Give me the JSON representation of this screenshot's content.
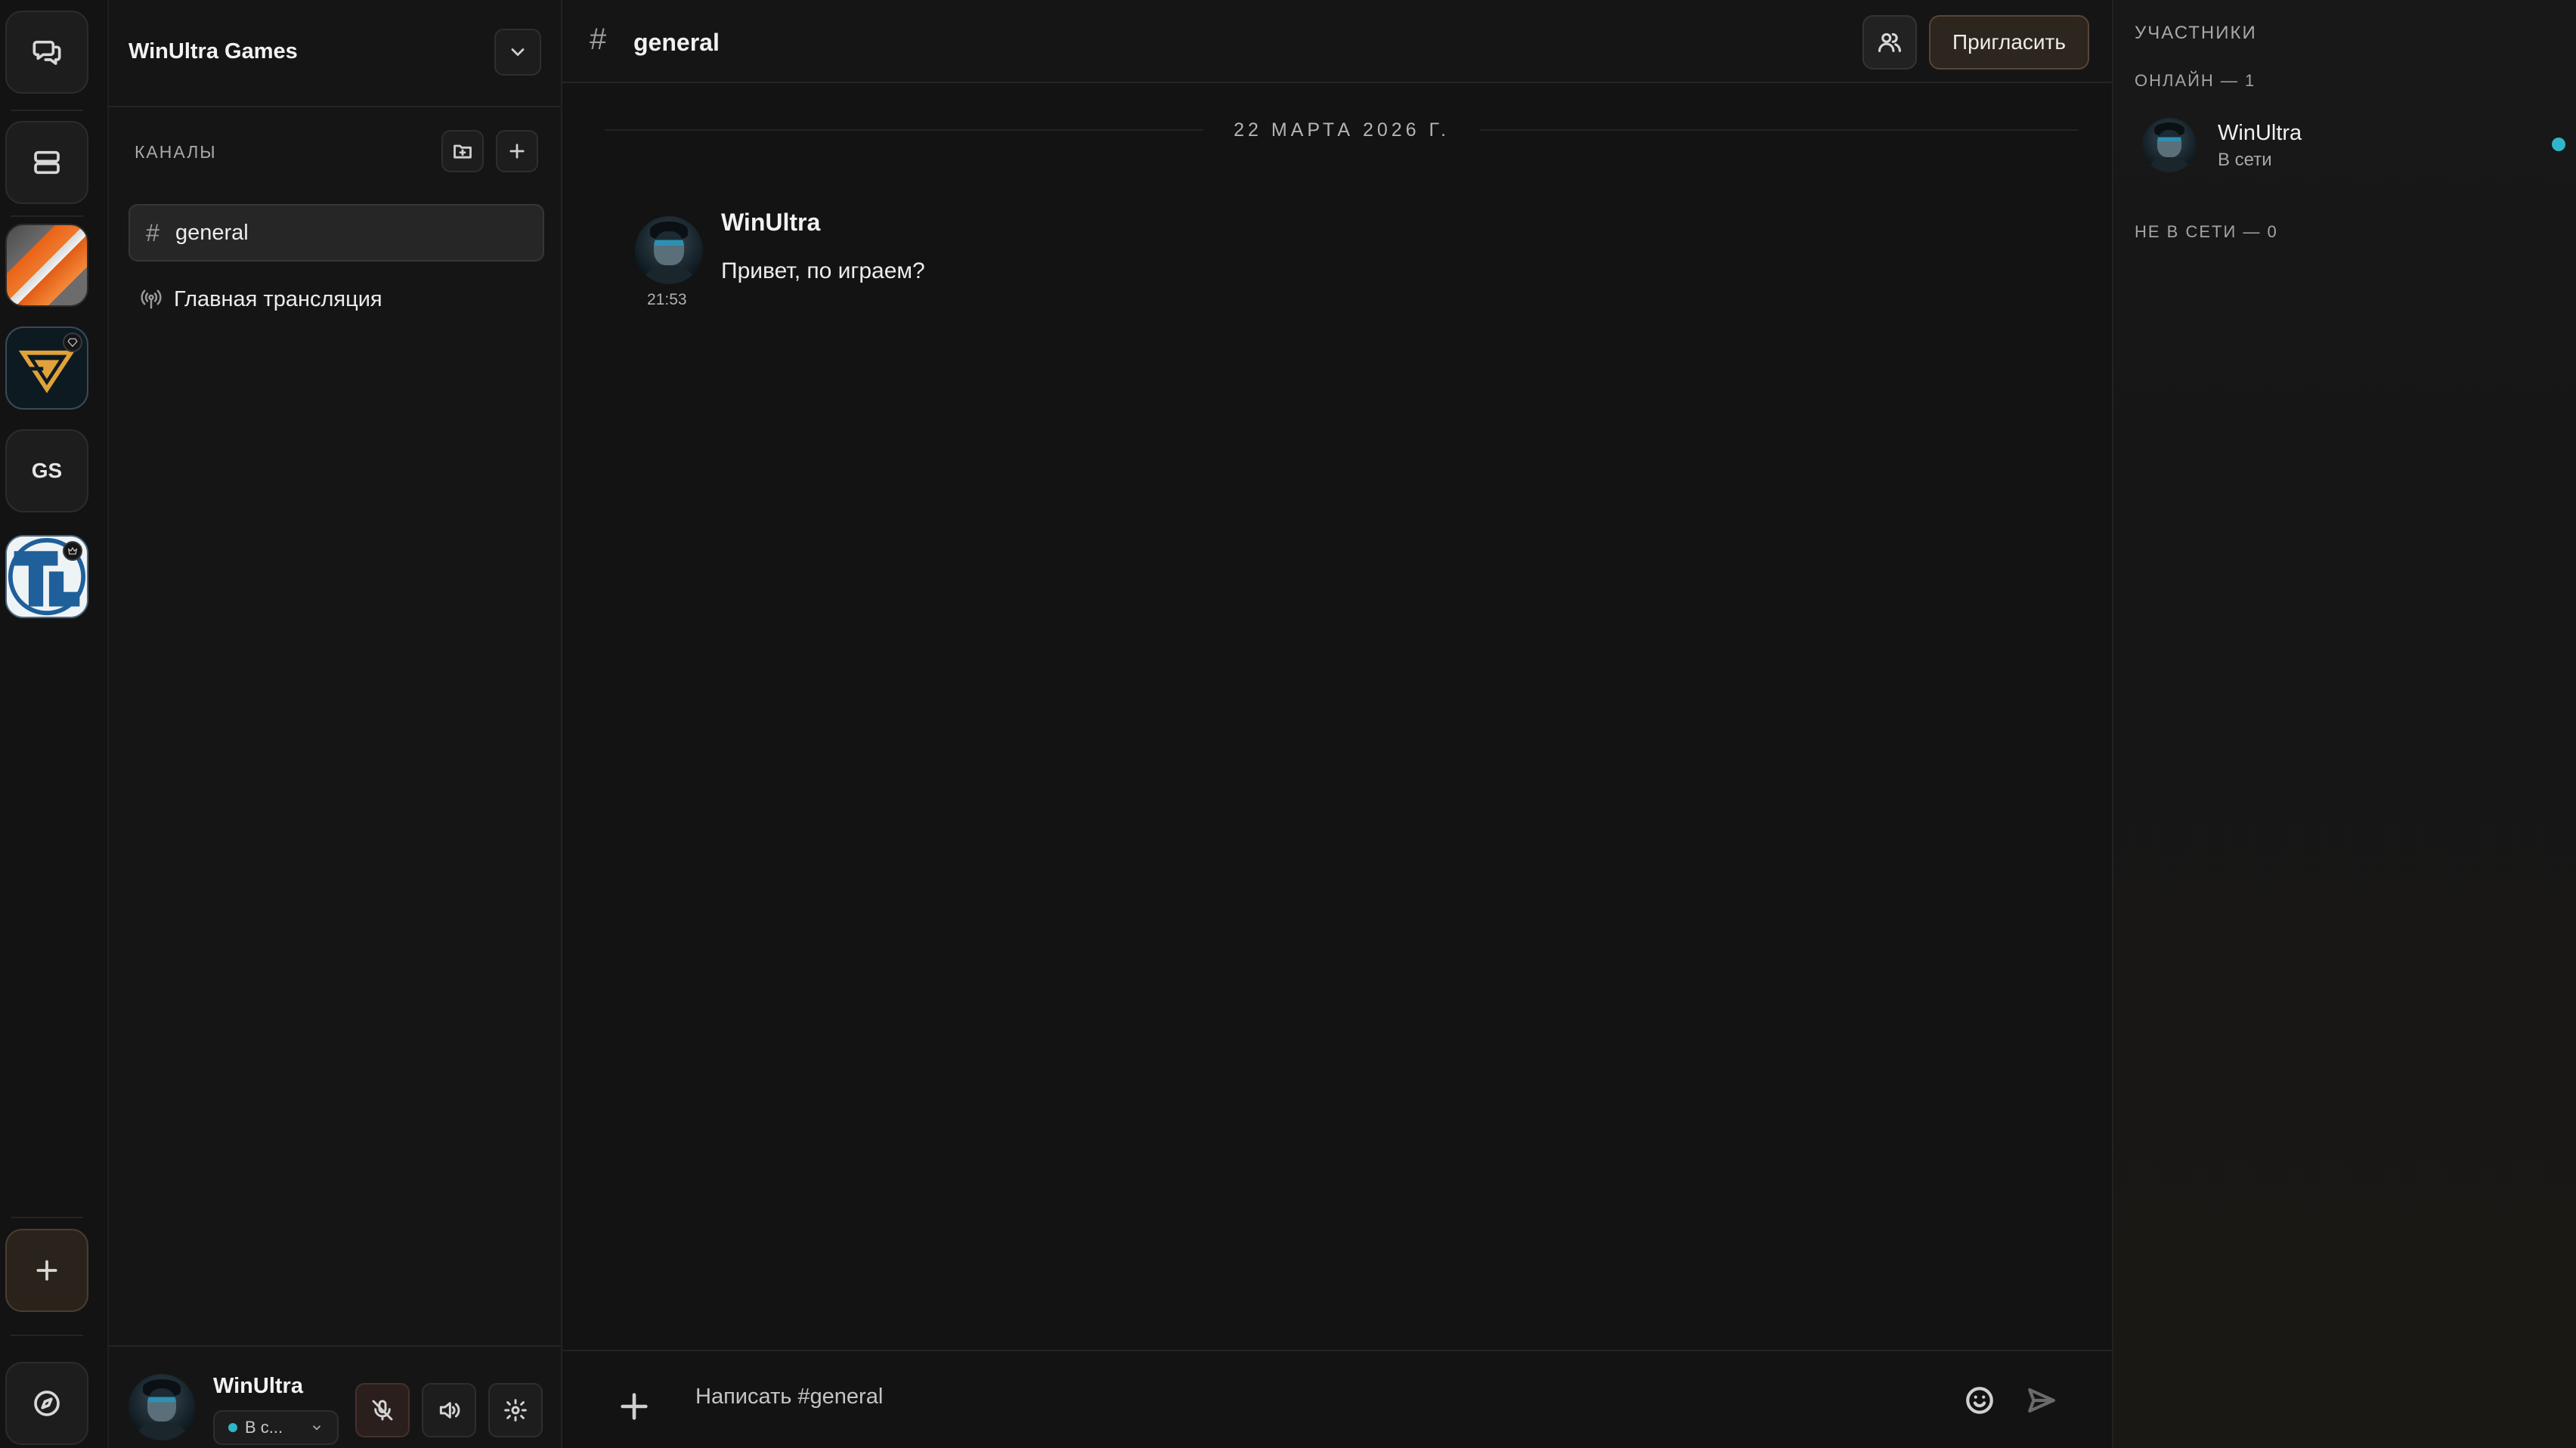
{
  "colors": {
    "accent_online": "#2fb6c9",
    "invite_button_bg": "#2d261f",
    "background": "#131313"
  },
  "rail": {
    "top_buttons": [
      "chat-bubbles-icon",
      "server-list-icon"
    ],
    "servers": [
      {
        "kind": "image",
        "name": "orange-stripes-server"
      },
      {
        "kind": "image",
        "name": "gold-logo-server",
        "badge": "diamond-icon"
      },
      {
        "kind": "text",
        "label": "GS"
      },
      {
        "kind": "image",
        "name": "blue-logo-server",
        "badge": "crown-icon"
      }
    ],
    "bottom_buttons": [
      "plus-icon",
      "compass-icon"
    ]
  },
  "sidebar": {
    "server_name": "WinUltra Games",
    "channels_label": "КАНАЛЫ",
    "channels": [
      {
        "type": "text",
        "icon": "hash-icon",
        "label": "general",
        "active": true
      },
      {
        "type": "broadcast",
        "icon": "broadcast-icon",
        "label": "Главная трансляция",
        "active": false
      }
    ]
  },
  "user_panel": {
    "name": "WinUltra",
    "status": "В с...",
    "controls": [
      "mic-off-icon",
      "speaker-icon",
      "gear-icon"
    ]
  },
  "chat": {
    "hash": "#",
    "channel_name": "general",
    "invite_label": "Пригласить",
    "date_divider": "22 МАРТА 2026 Г.",
    "messages": [
      {
        "author": "WinUltra",
        "time": "21:53",
        "text": "Привет, по играем?"
      }
    ],
    "composer_placeholder": "Написать #general"
  },
  "members": {
    "title": "УЧАСТНИКИ",
    "online_label": "ОНЛАЙН — 1",
    "offline_label": "НЕ В СЕТИ — 0",
    "online": [
      {
        "name": "WinUltra",
        "status": "В сети"
      }
    ]
  }
}
